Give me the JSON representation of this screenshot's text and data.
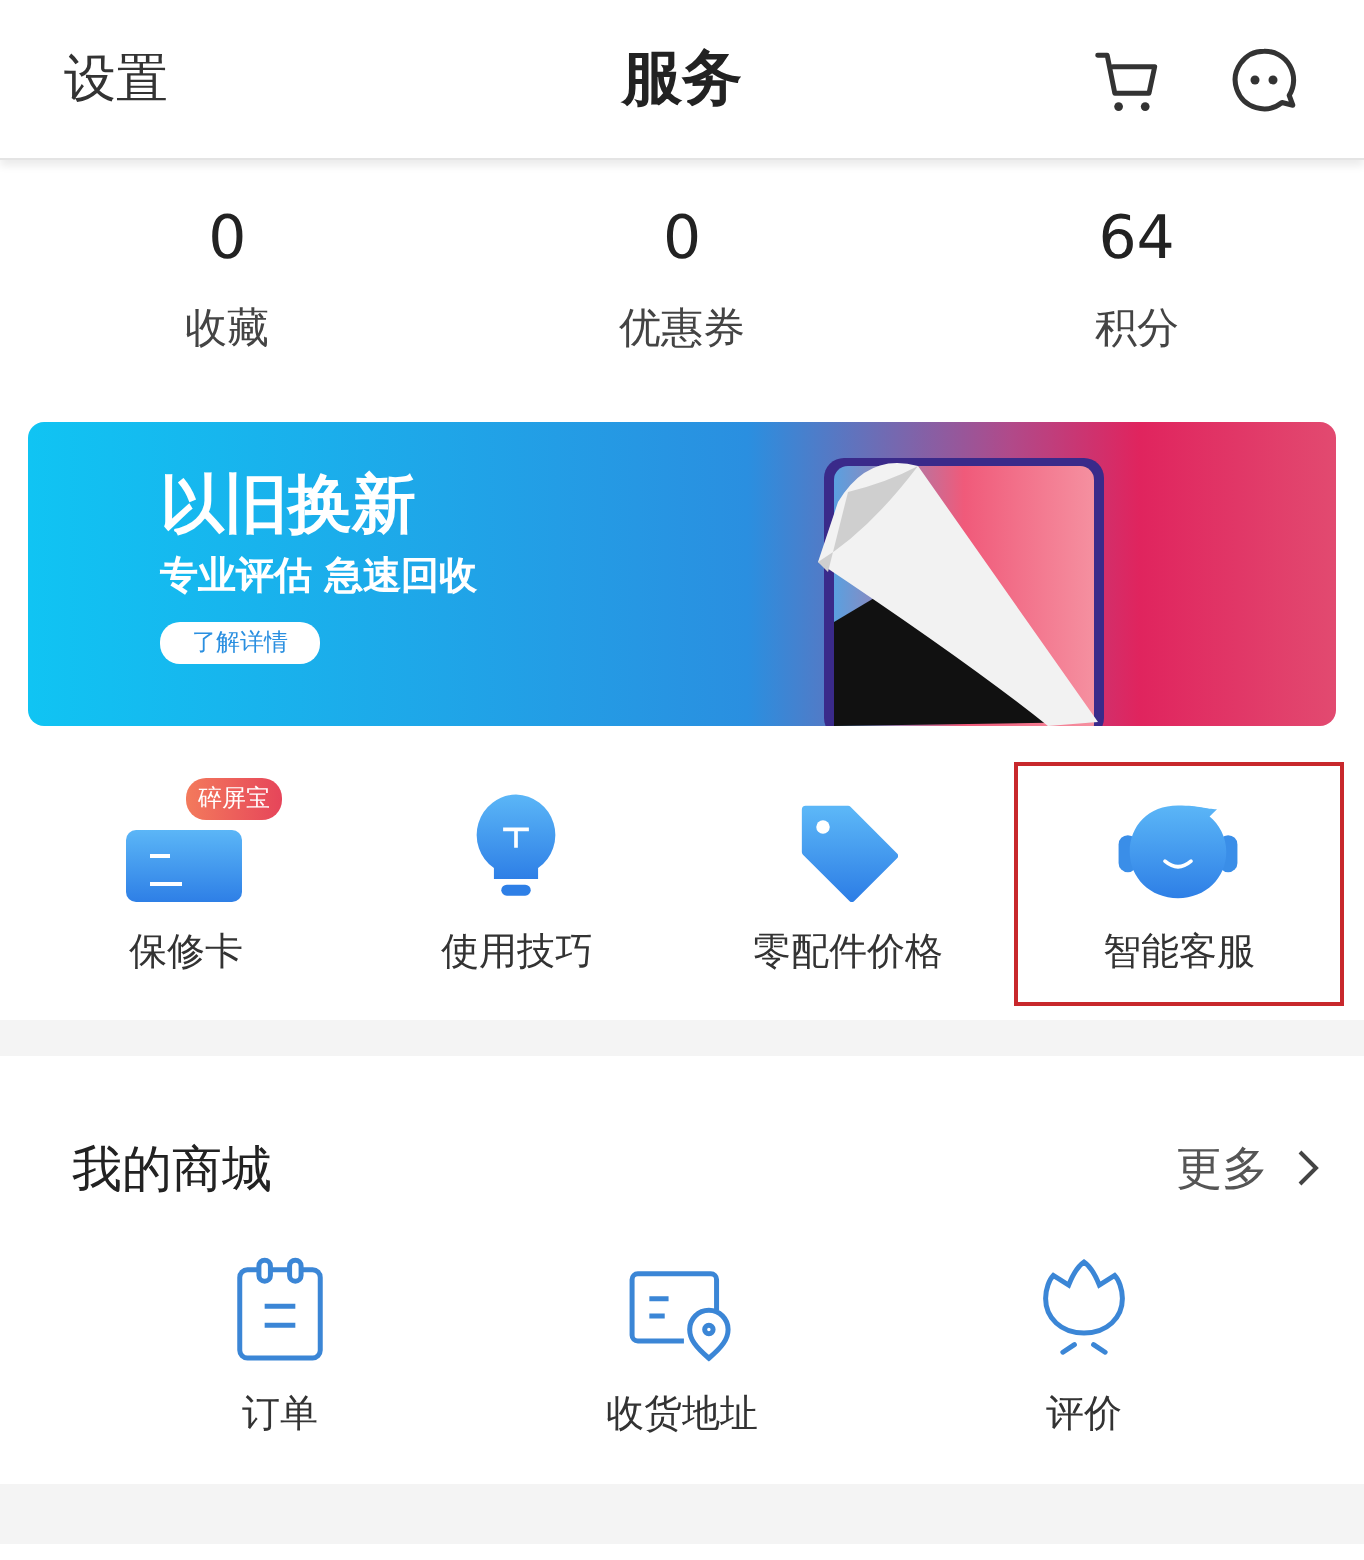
{
  "header": {
    "left_label": "设置",
    "title": "服务"
  },
  "stats": [
    {
      "value": "0",
      "label": "收藏"
    },
    {
      "value": "0",
      "label": "优惠券"
    },
    {
      "value": "64",
      "label": "积分"
    }
  ],
  "banner": {
    "kind": "picture",
    "headline": "以旧换新",
    "subline": "专业评估 急速回收",
    "button": "了解详情"
  },
  "services": [
    {
      "kind": "card",
      "label": "保修卡",
      "badge": "碎屏宝",
      "highlighted": false
    },
    {
      "kind": "bulb",
      "label": "使用技巧",
      "highlighted": false
    },
    {
      "kind": "tag",
      "label": "零配件价格",
      "highlighted": false
    },
    {
      "kind": "agent",
      "label": "智能客服",
      "highlighted": true
    }
  ],
  "mall": {
    "title": "我的商城",
    "more": "更多",
    "items": [
      {
        "kind": "order",
        "label": "订单"
      },
      {
        "kind": "address",
        "label": "收货地址"
      },
      {
        "kind": "review",
        "label": "评价"
      }
    ]
  }
}
